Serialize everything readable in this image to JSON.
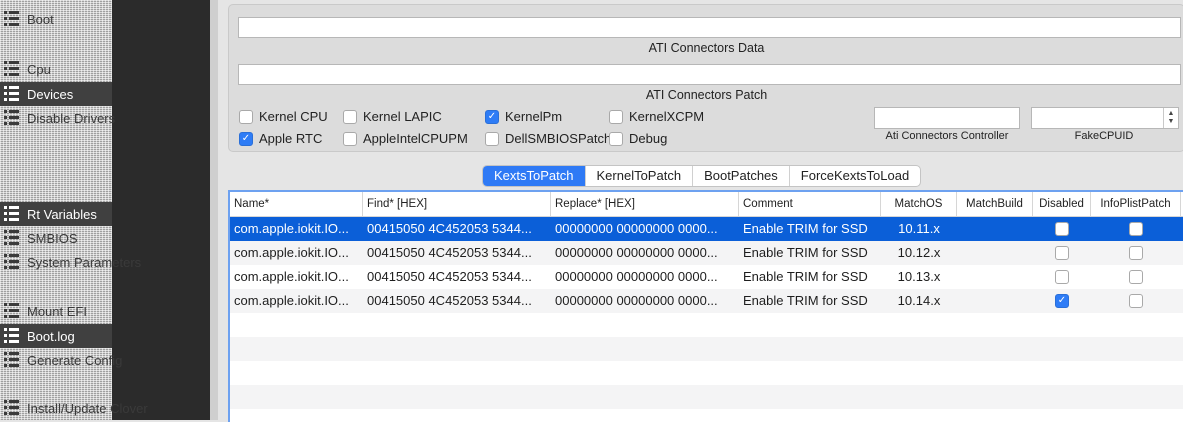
{
  "sidebar": {
    "items": [
      {
        "label": "Boot",
        "active": false
      },
      {
        "label": "Cpu",
        "active": false
      },
      {
        "label": "Devices",
        "active": true
      },
      {
        "label": "Disable Drivers",
        "active": false
      },
      {
        "label": "Rt Variables",
        "active": true
      },
      {
        "label": "SMBIOS",
        "active": false
      },
      {
        "label": "System Parameters",
        "active": false
      },
      {
        "label": "Mount EFI",
        "active": false
      },
      {
        "label": "Boot.log",
        "active": true
      },
      {
        "label": "Generate Config",
        "active": false
      },
      {
        "label": "Install/Update Clover",
        "active": false
      }
    ]
  },
  "ati": {
    "connectors_data_label": "ATI Connectors Data",
    "connectors_data_value": "",
    "connectors_patch_label": "ATI Connectors Patch",
    "connectors_patch_value": ""
  },
  "options": [
    {
      "label": "Kernel CPU",
      "checked": false
    },
    {
      "label": "Kernel LAPIC",
      "checked": false
    },
    {
      "label": "KernelPm",
      "checked": true
    },
    {
      "label": "KernelXCPM",
      "checked": false
    },
    {
      "label": "Apple RTC",
      "checked": true
    },
    {
      "label": "AppleIntelCPUPM",
      "checked": false
    },
    {
      "label": "DellSMBIOSPatch",
      "checked": false
    },
    {
      "label": "Debug",
      "checked": false
    }
  ],
  "fields": {
    "ati_controller_label": "Ati Connectors Controller",
    "ati_controller_value": "",
    "fake_cpuid_label": "FakeCPUID",
    "fake_cpuid_value": ""
  },
  "tabs": [
    "KextsToPatch",
    "KernelToPatch",
    "BootPatches",
    "ForceKextsToLoad"
  ],
  "active_tab": "KextsToPatch",
  "table": {
    "columns": [
      "Name*",
      "Find* [HEX]",
      "Replace* [HEX]",
      "Comment",
      "MatchOS",
      "MatchBuild",
      "Disabled",
      "InfoPlistPatch"
    ],
    "rows": [
      {
        "name": "com.apple.iokit.IO...",
        "find": "00415050 4C452053 5344...",
        "replace": "00000000 00000000 0000...",
        "comment": "Enable TRIM for SSD",
        "matchos": "10.11.x",
        "matchbuild": "",
        "disabled": false,
        "infoplist": false,
        "selected": true
      },
      {
        "name": "com.apple.iokit.IO...",
        "find": "00415050 4C452053 5344...",
        "replace": "00000000 00000000 0000...",
        "comment": "Enable TRIM for SSD",
        "matchos": "10.12.x",
        "matchbuild": "",
        "disabled": false,
        "infoplist": false,
        "selected": false
      },
      {
        "name": "com.apple.iokit.IO...",
        "find": "00415050 4C452053 5344...",
        "replace": "00000000 00000000 0000...",
        "comment": "Enable TRIM for SSD",
        "matchos": "10.13.x",
        "matchbuild": "",
        "disabled": false,
        "infoplist": false,
        "selected": false
      },
      {
        "name": "com.apple.iokit.IO...",
        "find": "00415050 4C452053 5344...",
        "replace": "00000000 00000000 0000...",
        "comment": "Enable TRIM for SSD",
        "matchos": "10.14.x",
        "matchbuild": "",
        "disabled": true,
        "infoplist": false,
        "selected": false
      }
    ],
    "empty_rows": 4
  },
  "colors": {
    "accent": "#2f7af5",
    "selection": "#0b5fd8",
    "sidebar_bg": "#2b2b2b"
  }
}
